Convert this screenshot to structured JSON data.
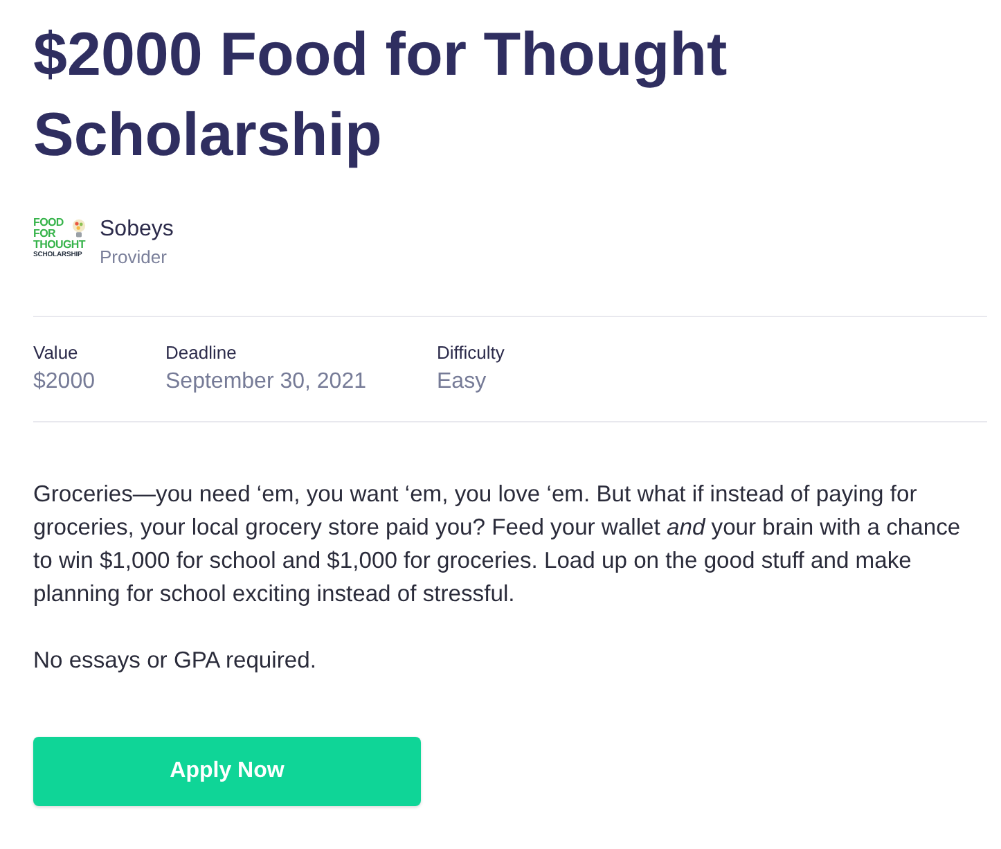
{
  "title": "$2000 Food for Thought Scholarship",
  "provider": {
    "logo": {
      "lines": [
        {
          "text": "FOOD",
          "kind": "accent"
        },
        {
          "text": "FOR",
          "kind": "accent"
        },
        {
          "text": "THOUGHT",
          "kind": "accent"
        },
        {
          "text": "SCHOLARSHIP",
          "kind": "plain"
        }
      ]
    },
    "name": "Sobeys",
    "role": "Provider"
  },
  "details": [
    {
      "label": "Value",
      "value": "$2000"
    },
    {
      "label": "Deadline",
      "value": "September 30, 2021"
    },
    {
      "label": "Difficulty",
      "value": "Easy"
    }
  ],
  "description": [
    "Groceries—you need ‘em, you want ‘em, you love ‘em. But what if instead of paying for groceries, your local grocery store paid you? Feed your wallet *and* your brain with a chance to win $1,000 for school and $1,000 for groceries. Load up on the good stuff and make planning for school exciting instead of stressful.",
    "No essays or GPA required."
  ],
  "apply_button": {
    "label": "Apply Now"
  }
}
